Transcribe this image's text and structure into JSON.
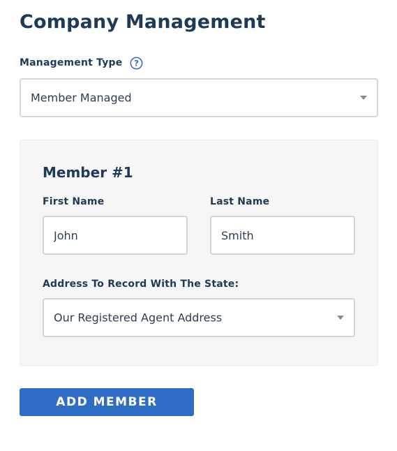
{
  "page": {
    "title": "Company Management"
  },
  "management": {
    "label": "Management Type",
    "help_icon": "question-circle-icon",
    "selected": "Member Managed"
  },
  "members": [
    {
      "heading": "Member #1",
      "first_name_label": "First Name",
      "first_name_value": "John",
      "last_name_label": "Last Name",
      "last_name_value": "Smith",
      "address_label": "Address To Record With The State:",
      "address_selected": "Our Registered Agent Address"
    }
  ],
  "actions": {
    "add_member_label": "ADD MEMBER"
  },
  "colors": {
    "heading": "#1f3a56",
    "accent": "#2f6cc4",
    "panel_bg": "#f6f6f6",
    "border": "#d9d6d1"
  }
}
